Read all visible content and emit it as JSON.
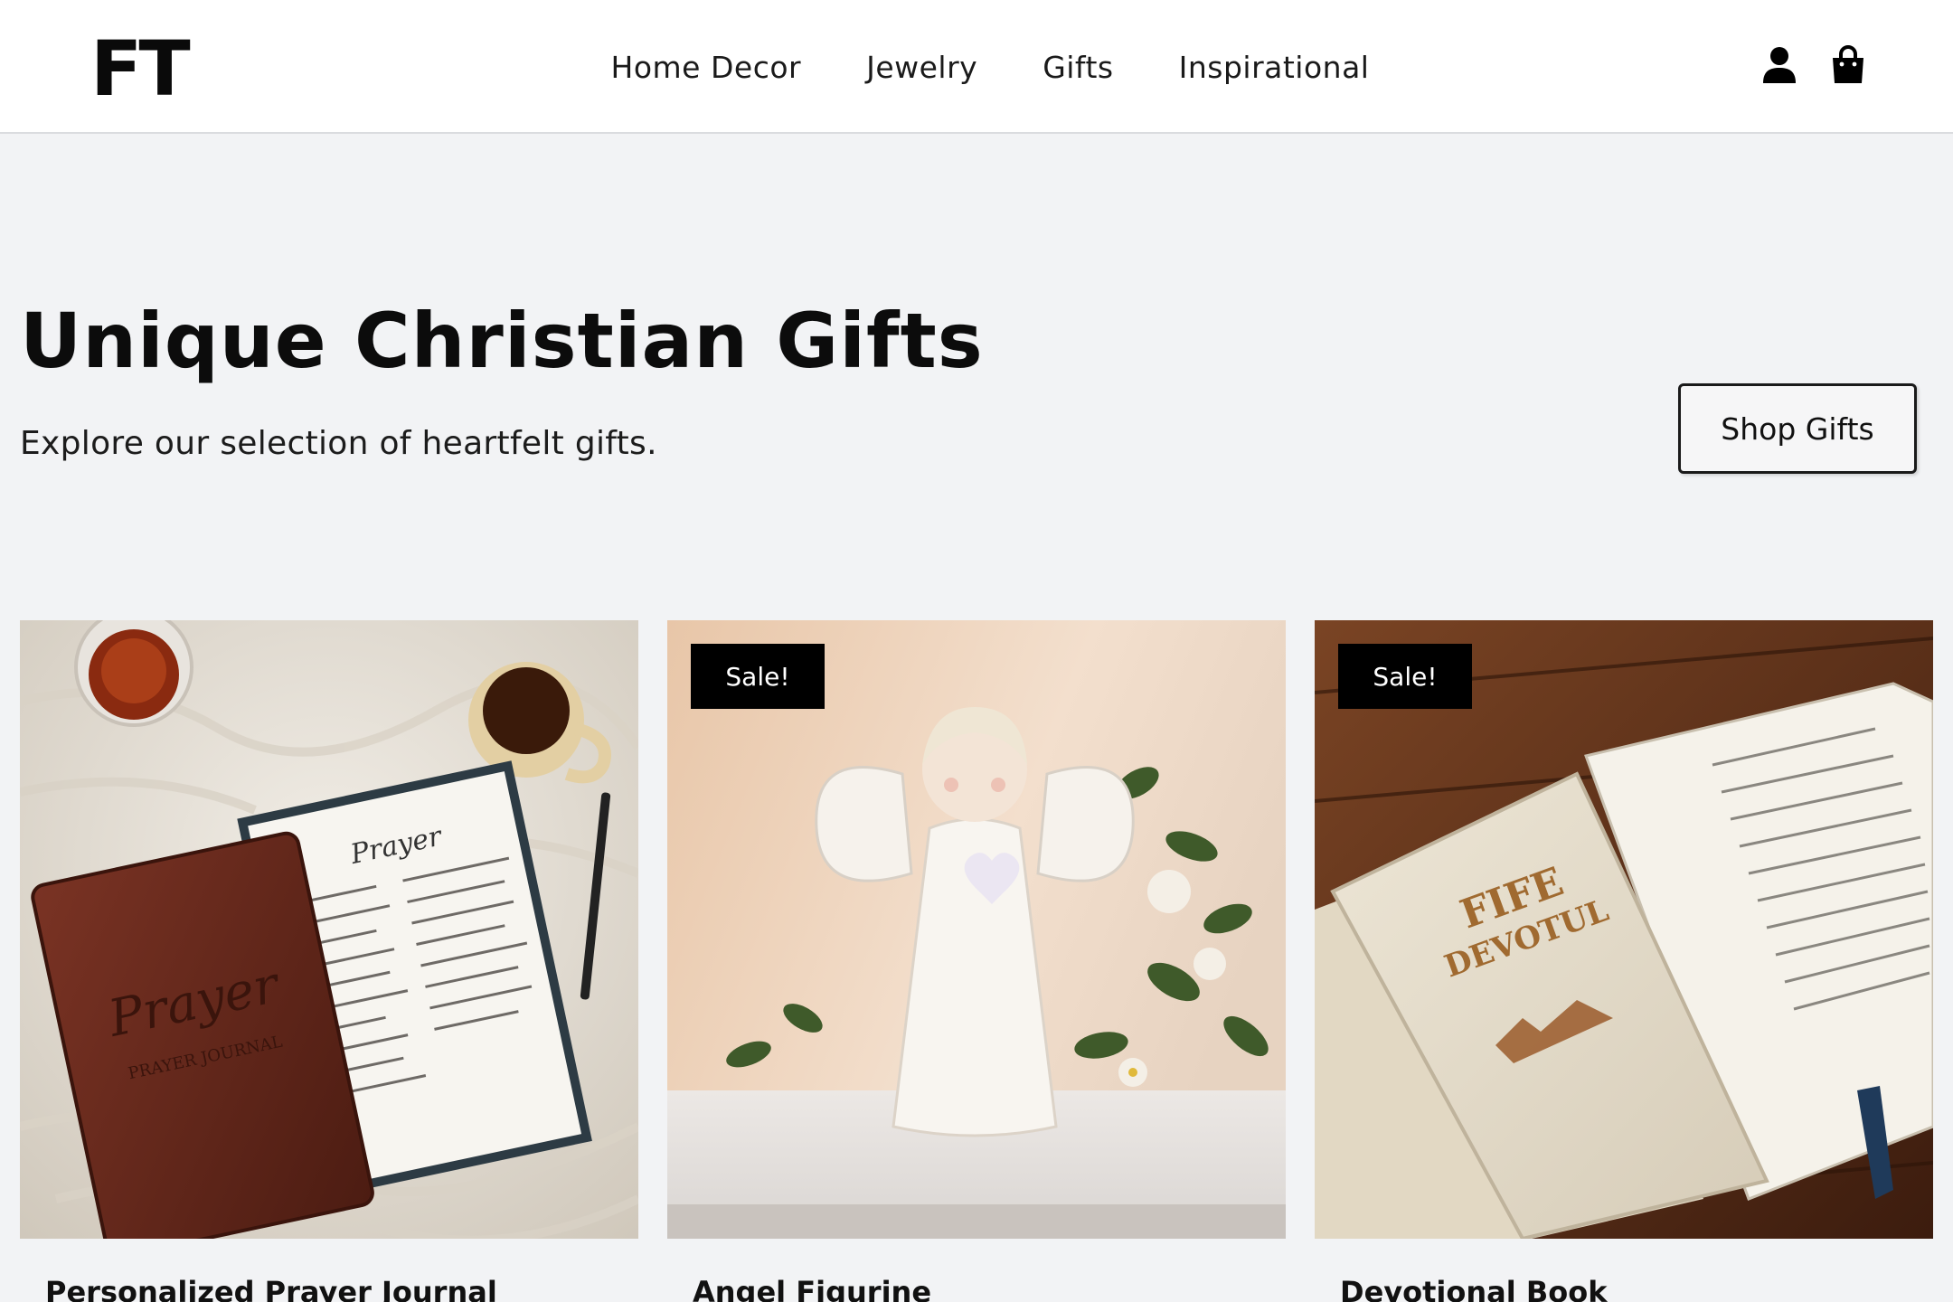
{
  "header": {
    "logo": "FT",
    "nav": [
      "Home Decor",
      "Jewelry",
      "Gifts",
      "Inspirational"
    ],
    "icons": [
      "user-icon",
      "shopping-bag-icon"
    ]
  },
  "hero": {
    "title": "Unique Christian Gifts",
    "subtitle": "Explore our selection of heartfelt gifts.",
    "cta": "Shop Gifts"
  },
  "products": [
    {
      "title": "Personalized Prayer Journal",
      "badge": "",
      "image": "prayer-journal-photo"
    },
    {
      "title": "Angel Figurine",
      "badge": "Sale!",
      "image": "angel-figurine-photo"
    },
    {
      "title": "Devotional Book",
      "badge": "Sale!",
      "image": "devotional-book-photo"
    }
  ],
  "image_text": {
    "journal_cover": "Prayer",
    "journal_subtitle": "PRAYER JOURNAL",
    "book_cover_line1": "FIFE",
    "book_cover_line2": "DEVOTUL"
  },
  "colors": {
    "page_bg": "#f2f3f5",
    "header_bg": "#ffffff",
    "badge_bg": "#000000",
    "text": "#111111"
  }
}
